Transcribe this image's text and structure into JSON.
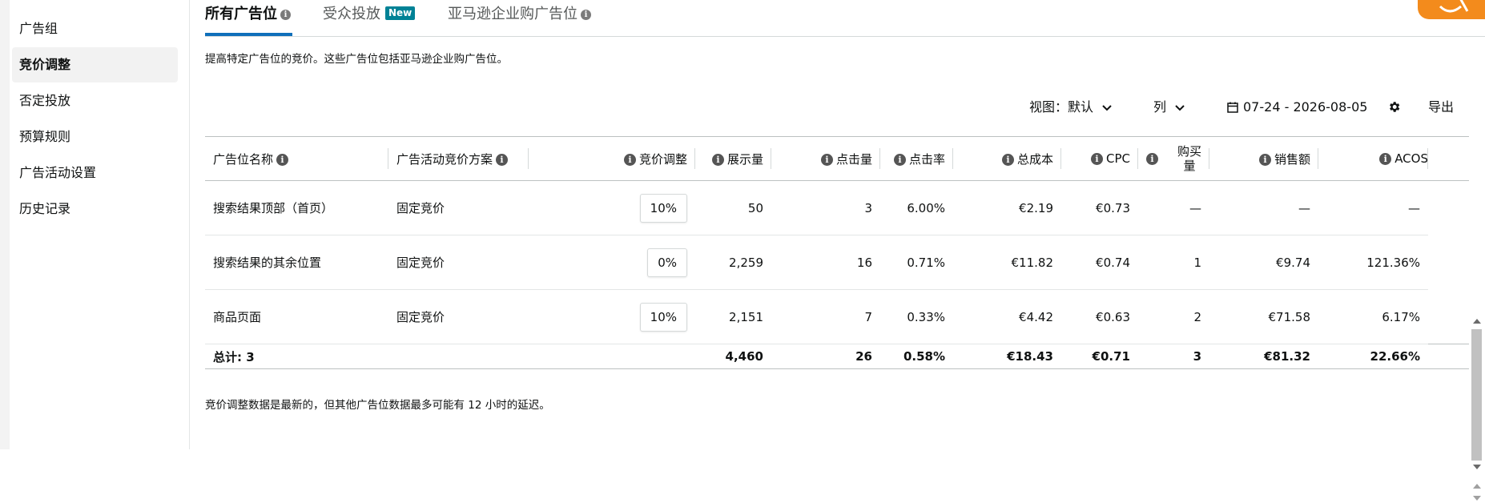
{
  "sidebar": {
    "items": [
      {
        "label": "广告组",
        "active": false
      },
      {
        "label": "竞价调整",
        "active": true
      },
      {
        "label": "否定投放",
        "active": false
      },
      {
        "label": "预算规则",
        "active": false
      },
      {
        "label": "广告活动设置",
        "active": false
      },
      {
        "label": "历史记录",
        "active": false
      }
    ]
  },
  "tabs": [
    {
      "label": "所有广告位",
      "active": true
    },
    {
      "label": "受众投放",
      "badge": "New"
    },
    {
      "label": "亚马逊企业购广告位"
    }
  ],
  "description": "提高特定广告位的竞价。这些广告位包括亚马逊企业购广告位。",
  "toolbar": {
    "view_label": "视图：默认",
    "columns_label": "列",
    "date_range": "07-24 - 2026-08-05",
    "export_label": "导出"
  },
  "table": {
    "headers": {
      "placement": "广告位名称",
      "strategy": "广告活动竞价方案",
      "bid_adjustment": "竞价调整",
      "impressions": "展示量",
      "clicks": "点击量",
      "ctr": "点击率",
      "spend": "总成本",
      "cpc": "CPC",
      "orders_line1": "购买",
      "orders_line2": "量",
      "sales": "销售额",
      "acos": "ACOS"
    },
    "rows": [
      {
        "placement": "搜索结果顶部（首页）",
        "strategy": "固定竞价",
        "bid_adjustment": "10%",
        "impressions": "50",
        "clicks": "3",
        "ctr": "6.00%",
        "spend": "€2.19",
        "cpc": "€0.73",
        "orders": "—",
        "sales": "—",
        "acos": "—"
      },
      {
        "placement": "搜索结果的其余位置",
        "strategy": "固定竞价",
        "bid_adjustment": "0%",
        "impressions": "2,259",
        "clicks": "16",
        "ctr": "0.71%",
        "spend": "€11.82",
        "cpc": "€0.74",
        "orders": "1",
        "sales": "€9.74",
        "acos": "121.36%"
      },
      {
        "placement": "商品页面",
        "strategy": "固定竞价",
        "bid_adjustment": "10%",
        "impressions": "2,151",
        "clicks": "7",
        "ctr": "0.33%",
        "spend": "€4.42",
        "cpc": "€0.63",
        "orders": "2",
        "sales": "€71.58",
        "acos": "6.17%"
      }
    ],
    "total": {
      "label": "总计: 3",
      "impressions": "4,460",
      "clicks": "26",
      "ctr": "0.58%",
      "spend": "€18.43",
      "cpc": "€0.71",
      "orders": "3",
      "sales": "€81.32",
      "acos": "22.66%"
    }
  },
  "footnote": "竞价调整数据是最新的，但其他广告位数据最多可能有 12 小时的延迟。",
  "colors": {
    "accent": "#0f6fba",
    "badge": "#008296",
    "corner": "#f38b1c"
  }
}
